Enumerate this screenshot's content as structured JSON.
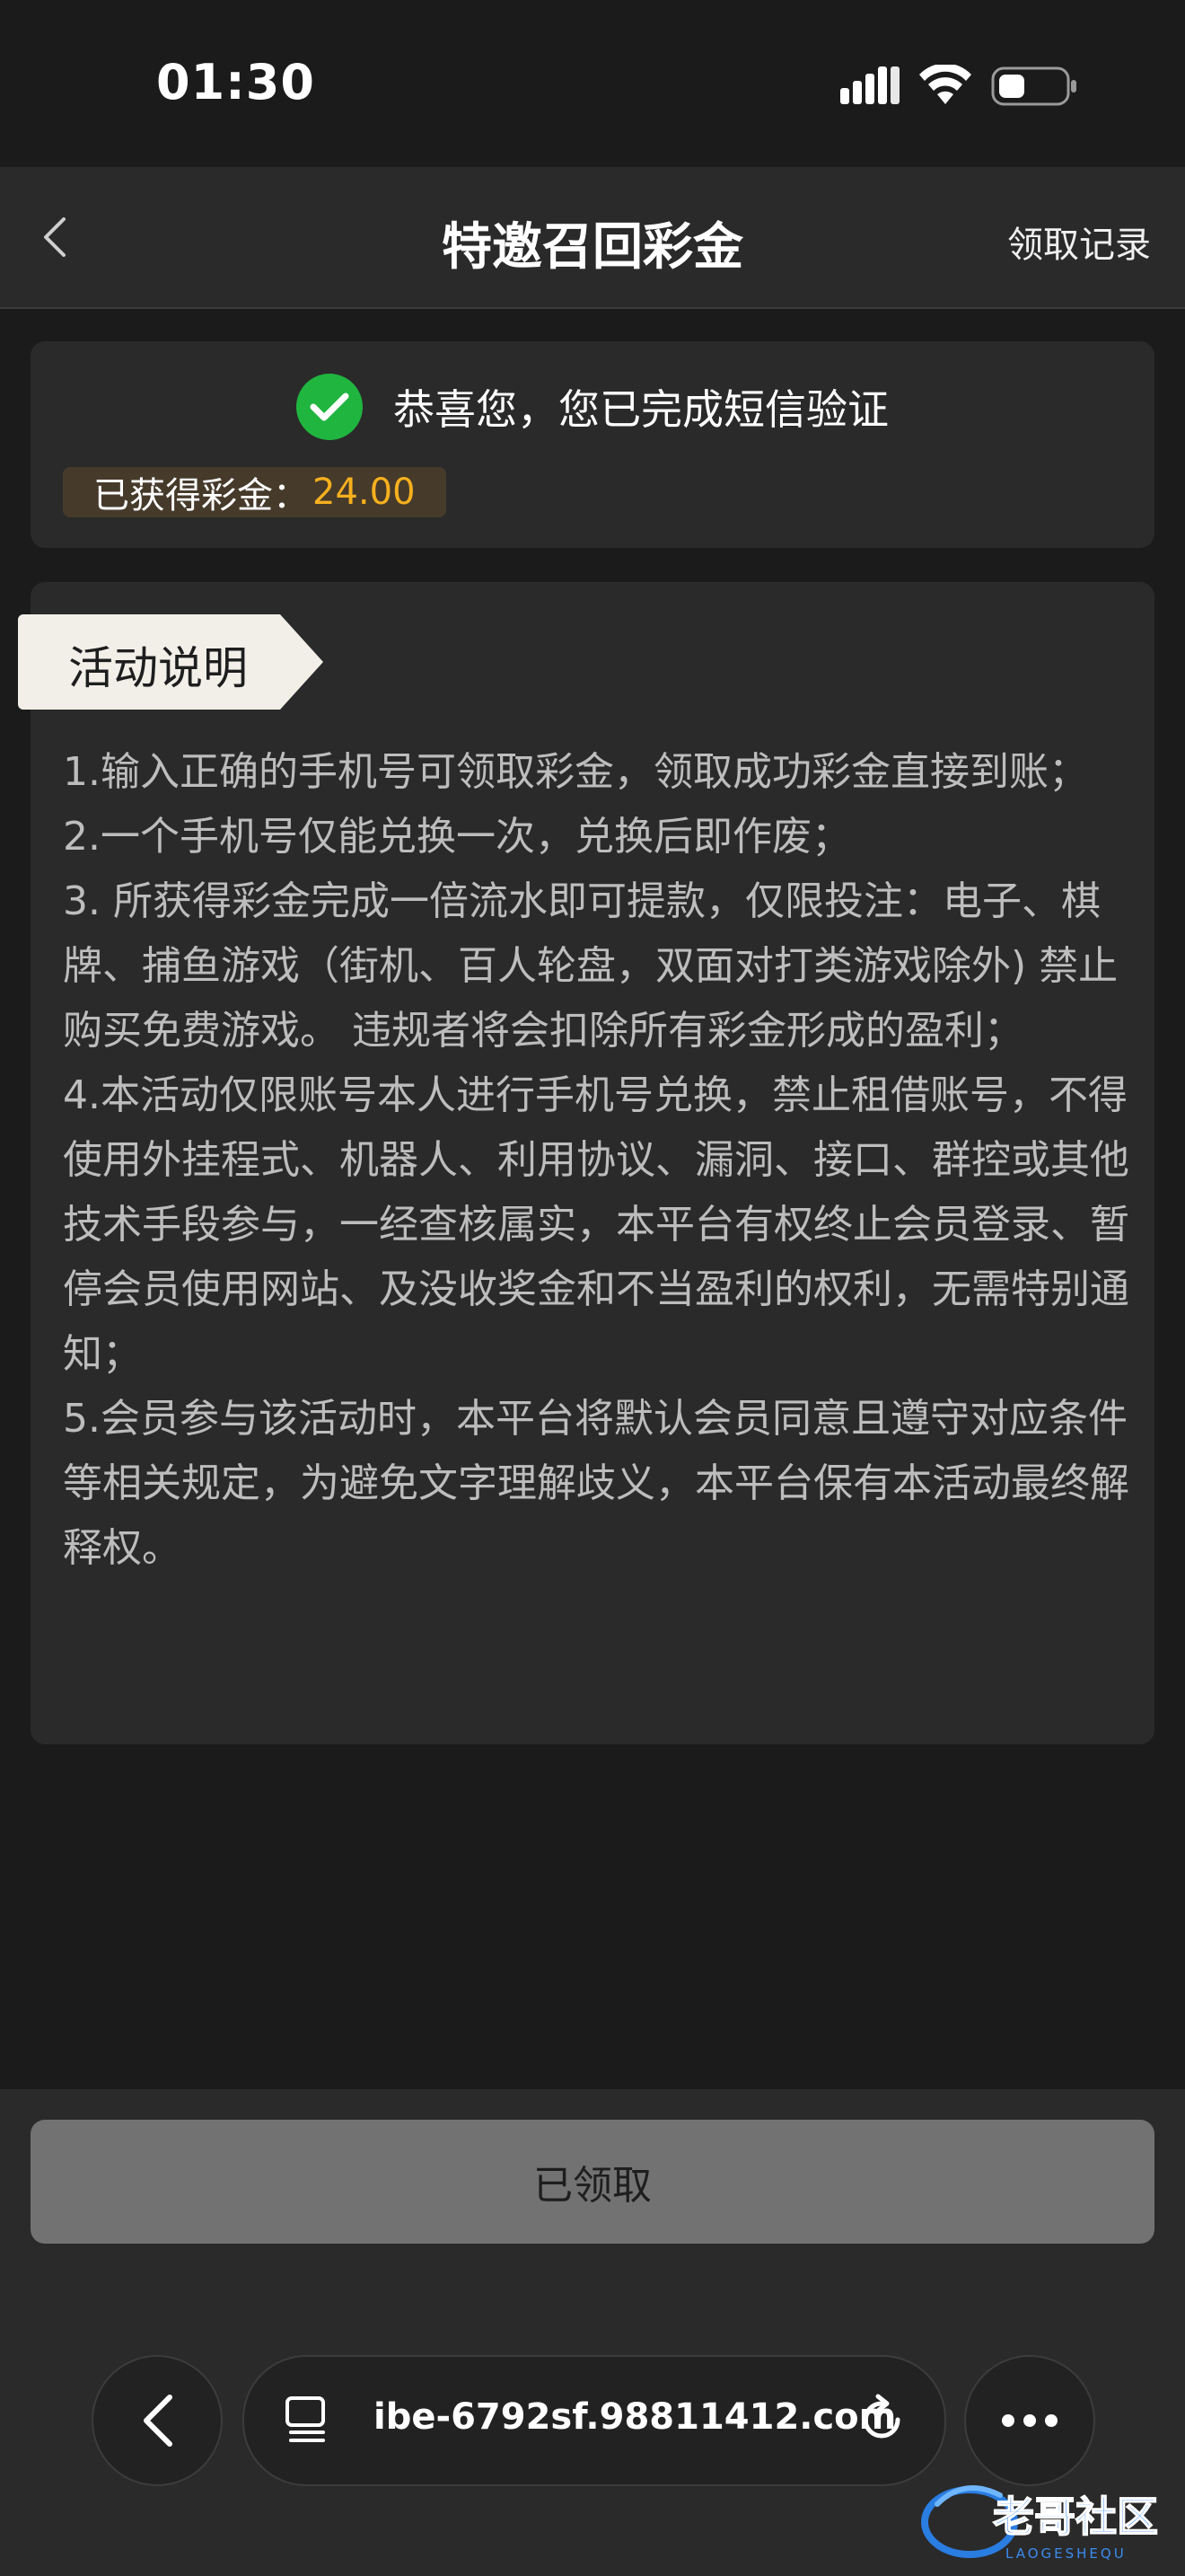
{
  "status_bar": {
    "time": "01:30"
  },
  "header": {
    "title": "特邀召回彩金",
    "records_label": "领取记录"
  },
  "success": {
    "message": "恭喜您，您已完成短信验证",
    "bonus_label": "已获得彩金：",
    "bonus_value": "24.00"
  },
  "rules": {
    "tab_label": "活动说明",
    "items": [
      "1.输入正确的手机号可领取彩金，领取成功彩金直接到账；",
      "2.一个手机号仅能兑换一次，兑换后即作废；",
      "3. 所获得彩金完成一倍流水即可提款，仅限投注：电子、棋牌、捕鱼游戏（街机、百人轮盘，双面对打类游戏除外) 禁止购买免费游戏。 违规者将会扣除所有彩金形成的盈利；",
      "4.本活动仅限账号本人进行手机号兑换，禁止租借账号，不得使用外挂程式、机器人、利用协议、漏洞、接口、群控或其他技术手段参与，一经查核属实，本平台有权终止会员登录、暂停会员使用网站、及没收奖金和不当盈利的权利，无需特别通知；",
      "5.会员参与该活动时，本平台将默认会员同意且遵守对应条件等相关规定，为避免文字理解歧义，本平台保有本活动最终解释权。"
    ]
  },
  "claim_button": {
    "label": "已领取"
  },
  "browser": {
    "url": "ibe-6792sf.98811412.com"
  },
  "watermark": {
    "text": "老哥社区",
    "subtext": "LAOGESHEQU"
  },
  "colors": {
    "background": "#1b1b1b",
    "card": "#2a2a2a",
    "accent_gold": "#f6b01e",
    "success_green": "#1fb53f",
    "disabled_button": "#727272"
  },
  "icons": {
    "back": "chevron-left-icon",
    "success": "check-circle-icon",
    "signal": "signal-icon",
    "wifi": "wifi-icon",
    "battery": "battery-icon",
    "tabs": "tabs-icon",
    "reload": "reload-icon",
    "more": "more-dots-icon"
  }
}
